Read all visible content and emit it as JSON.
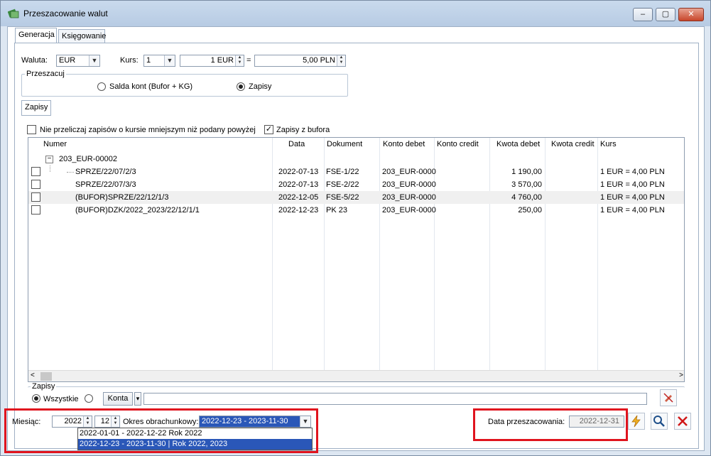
{
  "window": {
    "title": "Przeszacowanie walut",
    "controls": {
      "minimize": "–",
      "maximize": "▢",
      "close": "✕"
    }
  },
  "tabs": [
    {
      "label": "Generacja",
      "active": true
    },
    {
      "label": "Księgowanie",
      "active": false
    }
  ],
  "currency": {
    "label": "Waluta:",
    "value": "EUR",
    "rate_label": "Kurs:",
    "rate_type": "1",
    "amount_left": "1 EUR",
    "equals": "=",
    "amount_right": "5,00 PLN"
  },
  "revalue": {
    "group_title": "Przeszacuj",
    "options": [
      {
        "label": "Salda kont (Bufor + KG)",
        "selected": false
      },
      {
        "label": "Zapisy",
        "selected": true
      }
    ]
  },
  "subtab": {
    "label": "Zapisy"
  },
  "checkboxes": [
    {
      "label": "Nie przeliczaj zapisów o kursie mniejszym niż podany powyżej",
      "checked": false
    },
    {
      "label": "Zapisy z bufora",
      "checked": true
    }
  ],
  "table": {
    "columns": [
      "Numer",
      "Data",
      "Dokument",
      "Konto debet",
      "Konto credit",
      "Kwota debet",
      "Kwota credit",
      "Kurs"
    ],
    "group_row": {
      "toggle": "−",
      "label": "203_EUR-00002"
    },
    "rows": [
      {
        "numer": "SPRZE/22/07/2/3",
        "data": "2022-07-13",
        "dokument": "FSE-1/22",
        "konto_debet": "203_EUR-0000",
        "konto_credit": "",
        "kwota_debet": "1 190,00",
        "kwota_credit": "",
        "kurs": "1 EUR = 4,00 PLN"
      },
      {
        "numer": "SPRZE/22/07/3/3",
        "data": "2022-07-13",
        "dokument": "FSE-2/22",
        "konto_debet": "203_EUR-0000",
        "konto_credit": "",
        "kwota_debet": "3 570,00",
        "kwota_credit": "",
        "kurs": "1 EUR = 4,00 PLN"
      },
      {
        "numer": "(BUFOR)SPRZE/22/12/1/3",
        "data": "2022-12-05",
        "dokument": "FSE-5/22",
        "konto_debet": "203_EUR-0000",
        "konto_credit": "",
        "kwota_debet": "4 760,00",
        "kwota_credit": "",
        "kurs": "1 EUR = 4,00 PLN"
      },
      {
        "numer": "(BUFOR)DZK/2022_2023/22/12/1/1",
        "data": "2022-12-23",
        "dokument": "PK 23",
        "konto_debet": "203_EUR-0000",
        "konto_credit": "",
        "kwota_debet": "250,00",
        "kwota_credit": "",
        "kurs": "1 EUR = 4,00 PLN"
      }
    ],
    "scroll_left": "<",
    "scroll_right": ">"
  },
  "filter": {
    "group_title": "Zapisy",
    "option_all": "Wszystkie",
    "accounts_button": "Konta",
    "accounts_dropdown": "▾",
    "text_value": ""
  },
  "bottom": {
    "month_label": "Miesiąc:",
    "year_value": "2022",
    "month_value": "12",
    "period_label": "Okres obrachunkowy:",
    "period_value": "2022-12-23 - 2023-11-30",
    "period_options": [
      {
        "text": "2022-01-01 - 2022-12-22   Rok 2022",
        "selected": false
      },
      {
        "text": "2022-12-23 - 2023-11-30 | Rok 2022, 2023",
        "selected": true
      }
    ],
    "revalue_date_label": "Data przeszacowania:",
    "revalue_date_value": "2022-12-31"
  },
  "colors": {
    "highlight_border": "#e0141e",
    "selection": "#2a57b8",
    "window_frame": "#dde7f2"
  }
}
